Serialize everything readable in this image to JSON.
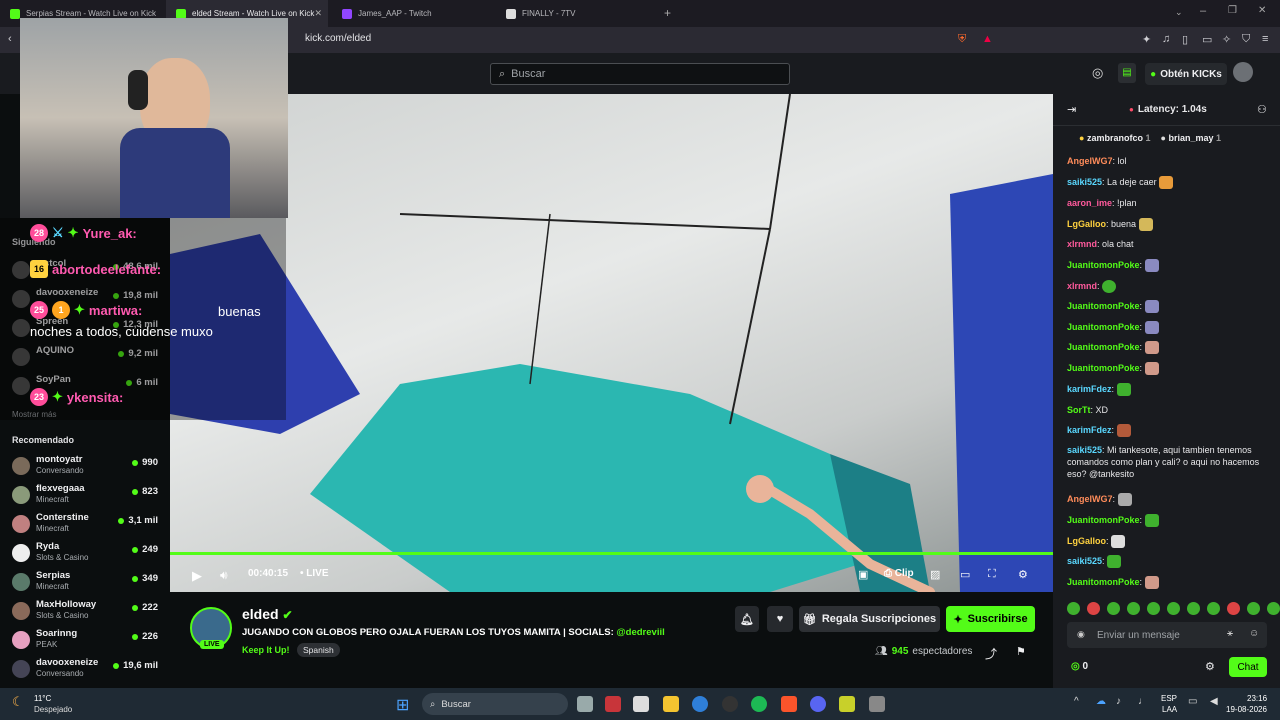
{
  "browser": {
    "tabs": [
      {
        "title": "Serpias Stream - Watch Live on Kick"
      },
      {
        "title": "elded Stream - Watch Live on Kick"
      },
      {
        "title": "James_AAP - Twitch"
      },
      {
        "title": "FINALLY - 7TV"
      }
    ],
    "url": "kick.com/elded"
  },
  "header": {
    "search_placeholder": "Buscar",
    "kicks_label": "Obtén KICKs"
  },
  "sidebar": {
    "following_title": "Siguiendo",
    "following": [
      {
        "name": "...stcol",
        "viewers": "48,6 mil"
      },
      {
        "name": "davooxeneize",
        "viewers": "19,8 mil"
      },
      {
        "name": "Spreen",
        "viewers": "12,3 mil"
      },
      {
        "name": "AQUINO",
        "viewers": "9,2 mil"
      },
      {
        "name": "SoyPan",
        "viewers": "6 mil"
      }
    ],
    "show_more": "Mostrar más",
    "recommended_title": "Recomendado",
    "recommended": [
      {
        "name": "montoyatr",
        "category": "Conversando",
        "viewers": "990"
      },
      {
        "name": "flexvegaaa",
        "category": "Minecraft",
        "viewers": "823"
      },
      {
        "name": "Conterstine",
        "category": "Minecraft",
        "viewers": "3,1 mil"
      },
      {
        "name": "Ryda",
        "category": "Slots & Casino",
        "viewers": "249"
      },
      {
        "name": "Serpias",
        "category": "Minecraft",
        "viewers": "349"
      },
      {
        "name": "MaxHolloway",
        "category": "Slots & Casino",
        "viewers": "222"
      },
      {
        "name": "Soarinng",
        "category": "PEAK",
        "viewers": "226"
      },
      {
        "name": "davooxeneize",
        "category": "Conversando",
        "viewers": "19,6 mil"
      }
    ]
  },
  "overlay_chat": [
    {
      "badge": "28",
      "user": "Yure_ak:",
      "text": ""
    },
    {
      "badge": "16",
      "user": "abortodeelefante:",
      "text": ""
    },
    {
      "badge": "25",
      "user": "martiwa:",
      "text": "buenas noches a todos, cuidense muxo"
    },
    {
      "badge": "23",
      "user": "ykensita:",
      "text": ""
    }
  ],
  "player": {
    "time": "00:40:15",
    "live_label": "LIVE",
    "clip_label": "Clip",
    "progress": 1.0
  },
  "stream": {
    "streamer": "elded",
    "live_badge": "LIVE",
    "title_main": "JUGANDO CON GLOBOS PERO OJALA FUERAN LOS TUYOS MAMITA | SOCIALS: ",
    "title_handle": "@dedreviil",
    "category": "Keep It Up!",
    "language": "Spanish",
    "gift_label": "Regala Suscripciones",
    "subscribe_label": "Suscribirse",
    "viewer_count": "945",
    "viewer_suffix": "espectadores"
  },
  "chat": {
    "latency": "Latency: 1.04s",
    "pinned": [
      {
        "user": "zambranofco",
        "count": "1"
      },
      {
        "user": "brian_may",
        "count": "1"
      }
    ],
    "messages": [
      {
        "user": "AngelWG7",
        "color": "#ff8c5a",
        "text": ": lol"
      },
      {
        "user": "saiki525",
        "color": "#5ad8ff",
        "text": ": La deje caer"
      },
      {
        "user": "aaron_ime",
        "color": "#ff5a9c",
        "text": ": !plan"
      },
      {
        "user": "LgGalloo",
        "color": "#ffd23f",
        "text": ": buena"
      },
      {
        "user": "xlrmnd",
        "color": "#ff5a9c",
        "text": ": ola chat"
      },
      {
        "user": "JuanitomonPoke",
        "color": "#53fc18",
        "text": ":"
      },
      {
        "user": "xlrmnd",
        "color": "#ff5a9c",
        "text": ":"
      },
      {
        "user": "JuanitomonPoke",
        "color": "#53fc18",
        "text": ":"
      },
      {
        "user": "JuanitomonPoke",
        "color": "#53fc18",
        "text": ":"
      },
      {
        "user": "JuanitomonPoke",
        "color": "#53fc18",
        "text": ":"
      },
      {
        "user": "JuanitomonPoke",
        "color": "#53fc18",
        "text": ":"
      },
      {
        "user": "karimFdez",
        "color": "#5ad8ff",
        "text": ":"
      },
      {
        "user": "SorTt",
        "color": "#53fc18",
        "text": ": XD"
      },
      {
        "user": "karimFdez",
        "color": "#5ad8ff",
        "text": ":"
      },
      {
        "user": "saiki525",
        "color": "#5ad8ff",
        "text": ": Mi tankesote, aqui tambien tenemos comandos como plan y cali? o aqui no hacemos eso? @tankesito"
      },
      {
        "user": "AngelWG7",
        "color": "#ff8c5a",
        "text": ":"
      },
      {
        "user": "JuanitomonPoke",
        "color": "#53fc18",
        "text": ":"
      },
      {
        "user": "LgGalloo",
        "color": "#ffd23f",
        "text": ":"
      },
      {
        "user": "saiki525",
        "color": "#5ad8ff",
        "text": ":"
      },
      {
        "user": "JuanitomonPoke",
        "color": "#53fc18",
        "text": ":"
      }
    ],
    "input_placeholder": "Enviar un mensaje",
    "points": "0",
    "send_label": "Chat"
  },
  "taskbar": {
    "weather_temp": "11°C",
    "weather_desc": "Despejado",
    "search": "Buscar",
    "lang": "ESP",
    "lang2": "LAA",
    "time": "23:16",
    "date": "19-08-2026"
  },
  "colors": {
    "accent": "#53fc18",
    "bg": "#0b0e0f",
    "panel": "#191b1f"
  }
}
